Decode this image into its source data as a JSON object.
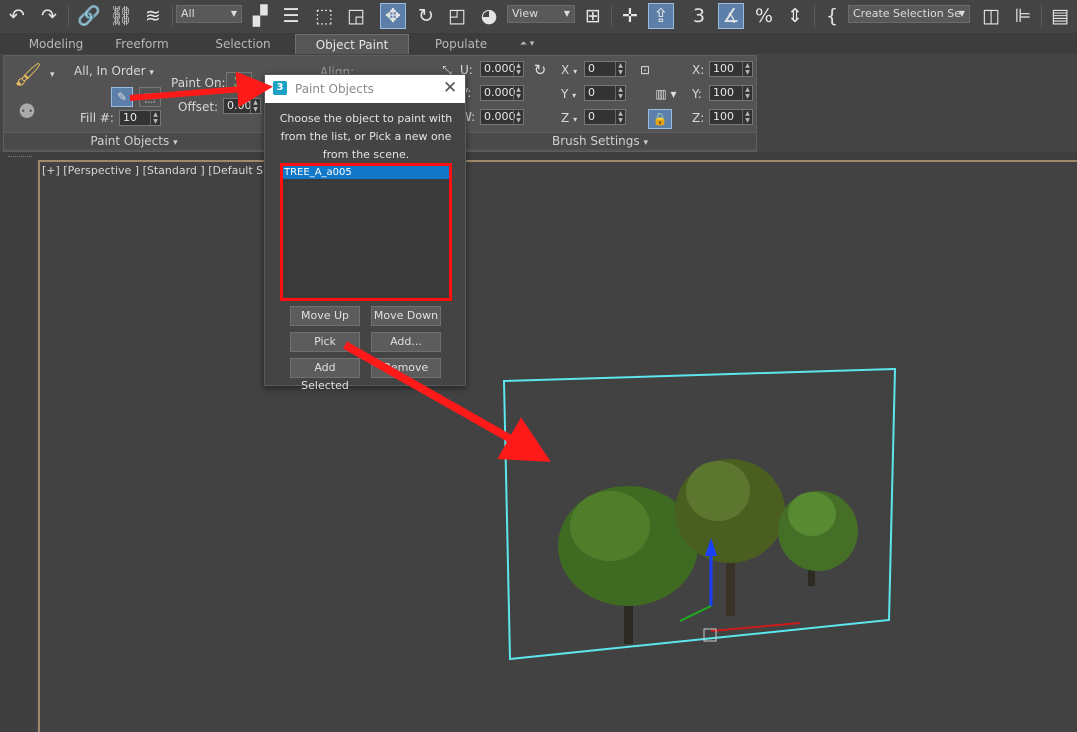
{
  "toolbar": {
    "filter_dropdown": "All",
    "view_dropdown": "View",
    "selection_set_dropdown": "Create Selection Se",
    "icons": [
      "undo-icon",
      "redo-icon",
      "link-icon",
      "unlink-icon",
      "bind-spacewarp-icon",
      "select-object-icon",
      "select-by-name-icon",
      "rect-region-icon",
      "window-crossing-icon",
      "move-icon",
      "rotate-icon",
      "scale-icon",
      "placement-icon",
      "use-pivot-icon",
      "select-manipulate-icon",
      "keyboard-shortcut-icon",
      "snaps-3d-icon",
      "angle-snap-icon",
      "percent-snap-icon",
      "spinner-snap-icon",
      "edit-named-sets-icon",
      "mirror-icon",
      "align-icon",
      "scene-explorer-icon"
    ]
  },
  "ribbon_tabs": [
    "Modeling",
    "Freeform",
    "Selection",
    "Object Paint",
    "Populate"
  ],
  "ribbon": {
    "order_dropdown": "All, In Order",
    "paint_on_label": "Paint On:",
    "offset_label": "Offset:",
    "offset_value": "0.00",
    "fill_label": "Fill #:",
    "fill_value": "10",
    "align_label": "Align:",
    "u_label": "U:",
    "u_value": "0.000",
    "v_label": "V:",
    "v_value": "0.000",
    "w_label": "W:",
    "w_value": "0.000",
    "rot_x_label": "X",
    "rot_x_value": "0",
    "rot_y_label": "Y",
    "rot_y_value": "0",
    "rot_z_label": "Z",
    "rot_z_value": "0",
    "scale_x_label": "X:",
    "scale_x_value": "100",
    "scale_y_label": "Y:",
    "scale_y_value": "100",
    "scale_z_label": "Z:",
    "scale_z_value": "100",
    "section_paint_objects": "Paint Objects",
    "section_brush_settings": "Brush Settings"
  },
  "viewport": {
    "label": "[+] [Perspective ] [Standard ] [Default Shadi"
  },
  "dialog": {
    "logo": "3",
    "title": "Paint Objects",
    "description": "Choose the object to paint with from the list, or Pick a new one from the scene.",
    "list_items": [
      "TREE_A_a005"
    ],
    "buttons": {
      "move_up": "Move Up",
      "move_down": "Move Down",
      "pick": "Pick",
      "add": "Add...",
      "add_selected": "Add Selected",
      "remove": "Remove"
    }
  },
  "colors": {
    "arrow": "#ff1a1a",
    "highlight": "#ff1010",
    "selection_bounds": "#5ee6ee",
    "list_selected": "#1178c9",
    "active_tool": "#5b7fa8"
  }
}
